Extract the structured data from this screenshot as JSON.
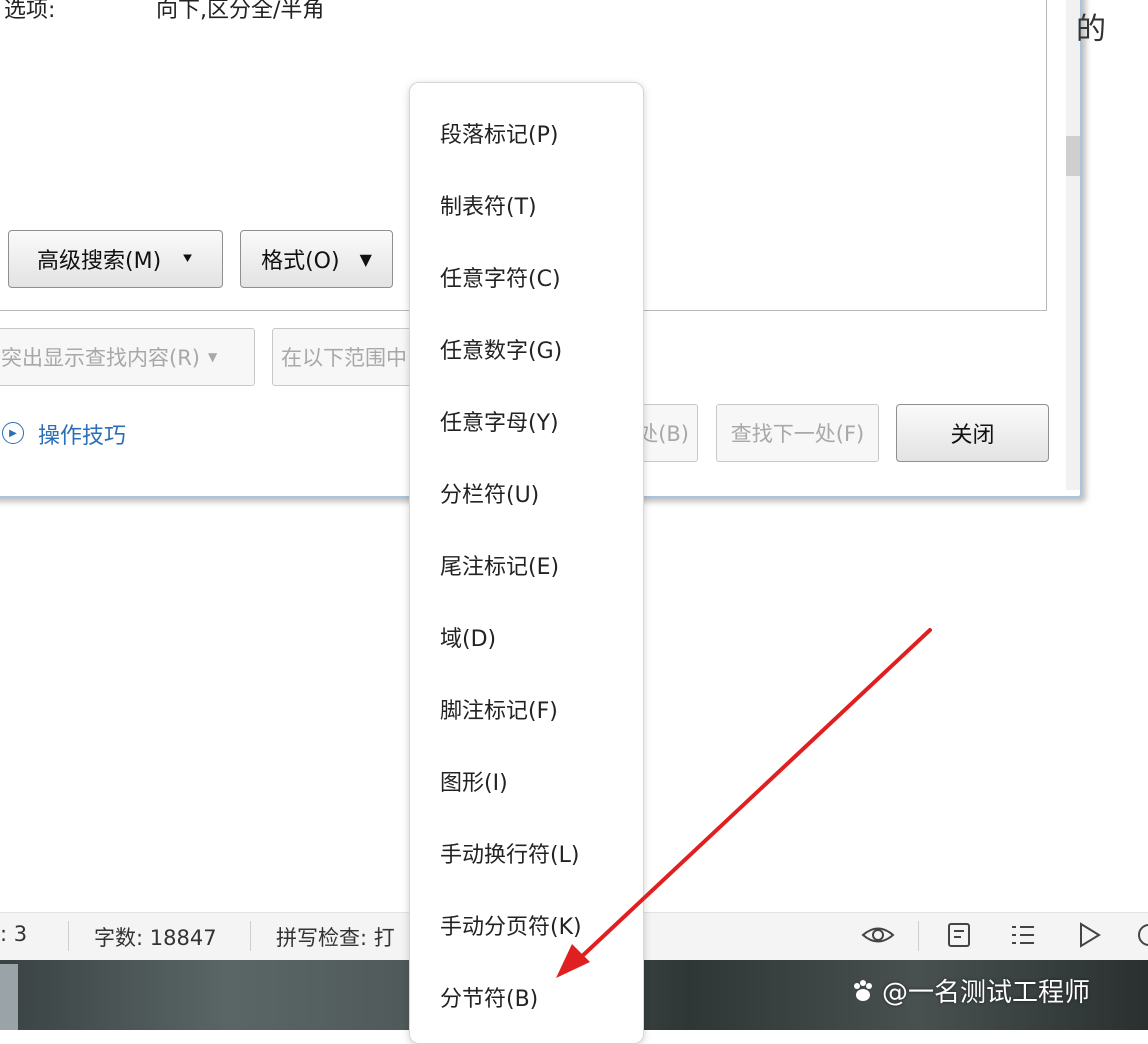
{
  "dialog": {
    "options_label": "选项:",
    "options_value": "向下,区分全/半角",
    "right_edge_char": "的",
    "advanced_search_button": "高级搜索(M)",
    "format_button": "格式(O)",
    "highlight_button": "突出显示查找内容(R)",
    "find_in_button": "在以下范围中",
    "find_prev_button": "处(B)",
    "find_next_button": "查找下一处(F)",
    "close_button": "关闭",
    "tips_link": "操作技巧"
  },
  "menu": {
    "items": [
      "段落标记(P)",
      "制表符(T)",
      "任意字符(C)",
      "任意数字(G)",
      "任意字母(Y)",
      "分栏符(U)",
      "尾注标记(E)",
      "域(D)",
      "脚注标记(F)",
      "图形(I)",
      "手动换行符(L)",
      "手动分页符(K)",
      "分节符(B)"
    ]
  },
  "statusbar": {
    "page_fragment": ": 3",
    "word_count": "字数: 18847",
    "spell_check": "拼写检查: 打"
  },
  "watermark": "@一名测试工程师",
  "icons": [
    "play-circle-icon",
    "eye-icon",
    "page-view-icon",
    "outline-view-icon",
    "play-icon",
    "zoom-icon",
    "paw-icon",
    "arrow-annotation"
  ],
  "colors": {
    "link": "#2a6fb8",
    "arrow": "#e02020"
  }
}
